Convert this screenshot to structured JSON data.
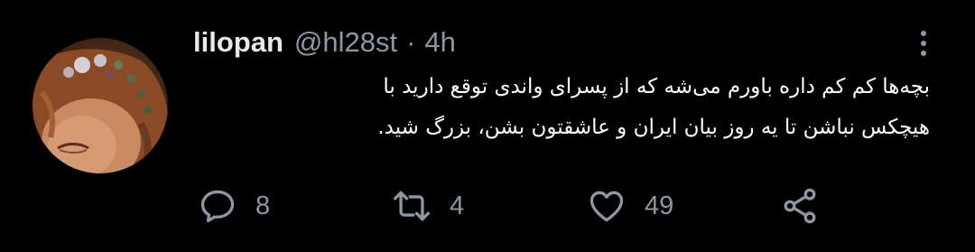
{
  "tweet": {
    "author_name": "lilopan",
    "handle": "@hl28st",
    "separator": "·",
    "time": "4h",
    "lines": [
      "بچه‌ها کم کم داره باورم می‌شه که از پسرای واندی توقع دارید با",
      "هیچکس نباشن تا یه روز بیان ایران و عاشقتون بشن، بزرگ شید."
    ]
  },
  "actions": {
    "replies": "8",
    "retweets": "4",
    "likes": "49"
  },
  "icons": {
    "reply": "reply-icon",
    "retweet": "retweet-icon",
    "like": "heart-icon",
    "share": "share-icon",
    "more": "more-icon"
  },
  "colors": {
    "background": "#000000",
    "text": "#ffffff",
    "secondary": "#8b98a5"
  }
}
